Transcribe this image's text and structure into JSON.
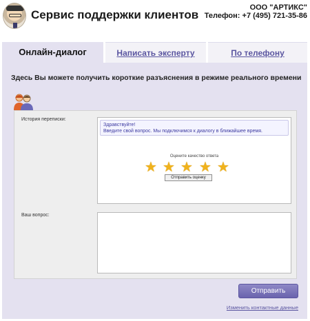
{
  "header": {
    "title": "Сервис поддержки клиентов",
    "company": "ООО \"АРТИКС\"",
    "phone": "Телефон: +7 (495) 721-35-86"
  },
  "tabs": [
    {
      "label": "Онлайн-диалог",
      "active": true
    },
    {
      "label": "Написать эксперту",
      "active": false
    },
    {
      "label": "По телефону",
      "active": false
    }
  ],
  "intro": "Здесь Вы можете получить короткие разъяснения в режиме реального времени",
  "chat": {
    "history_label": "История переписки:",
    "greeting_line1": "Здравствуйте!",
    "greeting_line2": "Введите свой вопрос. Мы подключимся к диалогу в ближайшее время.",
    "rating_prompt": "Оцените качество ответа",
    "rating_stars": 5,
    "rating_button": "Отправить оценку"
  },
  "question": {
    "label": "Ваш вопрос:",
    "value": ""
  },
  "send_button": "Отправить",
  "change_contacts_link": "Изменить контактные данные",
  "colors": {
    "accent": "#6a63ad",
    "panel": "#e4e1f0",
    "link": "#5a55a0",
    "star": "#f0b21c"
  }
}
